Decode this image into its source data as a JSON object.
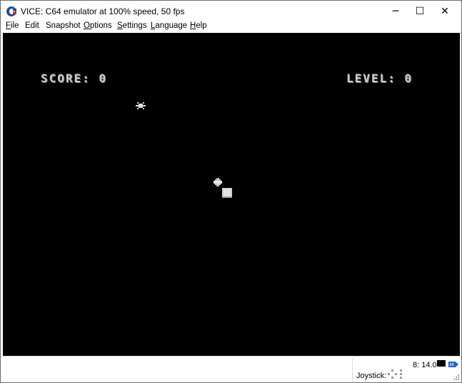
{
  "window": {
    "title": "VICE: C64 emulator at 100% speed, 50 fps",
    "icon": "commodore-logo-icon",
    "controls": [
      "minimize",
      "maximize",
      "close"
    ],
    "control_glyphs": {
      "minimize": "─",
      "maximize": "☐",
      "close": "✕"
    }
  },
  "menubar": {
    "items": [
      {
        "accel": "F",
        "rest": "ile"
      },
      {
        "accel": "",
        "rest": "Edit"
      },
      {
        "accel": "",
        "rest": "Snapshot"
      },
      {
        "accel": "O",
        "rest": "ptions"
      },
      {
        "accel": "S",
        "rest": "ettings"
      },
      {
        "accel": "L",
        "rest": "anguage"
      },
      {
        "accel": "H",
        "rest": "elp"
      }
    ]
  },
  "game": {
    "score_label": "SCORE: 0",
    "level_label": "LEVEL: 0",
    "background": "#000000",
    "text_color": "#c8c8c8"
  },
  "statusbar": {
    "drive_status": "8: 14.0",
    "joystick_label": "Joystick:"
  }
}
